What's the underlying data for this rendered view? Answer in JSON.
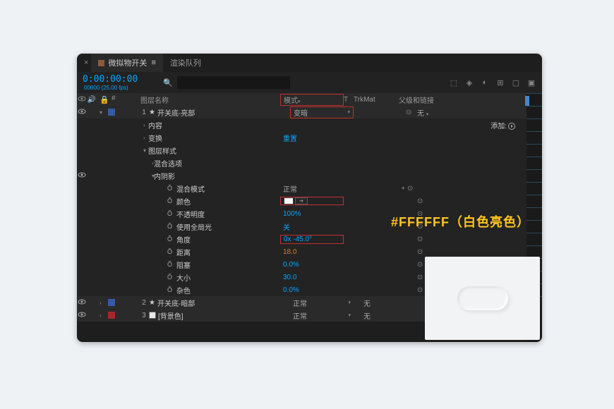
{
  "tabs": {
    "active": "微拟物开关",
    "inactive": "渲染队列"
  },
  "timecode": "0:00:00:00",
  "fps": "00000 (25.00 fps)",
  "headers": {
    "switches": "#",
    "name": "图层名称",
    "mode": "模式",
    "t": "T",
    "trkmat": "TrkMat",
    "parent": "父级和链接"
  },
  "layers": [
    {
      "num": "1",
      "name": "开关底-亮部",
      "mode": "变暗",
      "parent": "无",
      "color": "blue"
    },
    {
      "num": "2",
      "name": "开关底-暗部",
      "mode": "正常",
      "trk": "无",
      "color": "blue"
    },
    {
      "num": "3",
      "name": "[背景色]",
      "mode": "正常",
      "trk": "无",
      "color": "red",
      "solid": true
    }
  ],
  "groups": {
    "contents": "内容",
    "transform": "变换",
    "transform_val": "重置",
    "layerstyle": "图层样式",
    "blendopts": "混合选项",
    "innershadow": "内阴影",
    "add": "添加:"
  },
  "props": [
    {
      "name": "混合模式",
      "val": "正常",
      "type": "dropdown"
    },
    {
      "name": "颜色",
      "val": "",
      "type": "color"
    },
    {
      "name": "不透明度",
      "val": "100%",
      "type": "blue"
    },
    {
      "name": "使用全局光",
      "val": "关",
      "type": "blue"
    },
    {
      "name": "角度",
      "val": "0x -45.0°",
      "type": "blue",
      "red": true
    },
    {
      "name": "距离",
      "val": "18.0",
      "type": "orange"
    },
    {
      "name": "阻塞",
      "val": "0.0%",
      "type": "blue"
    },
    {
      "name": "大小",
      "val": "30.0",
      "type": "blue"
    },
    {
      "name": "杂色",
      "val": "0.0%",
      "type": "blue"
    }
  ],
  "annotation": "#FFFFFF（白色亮色）"
}
